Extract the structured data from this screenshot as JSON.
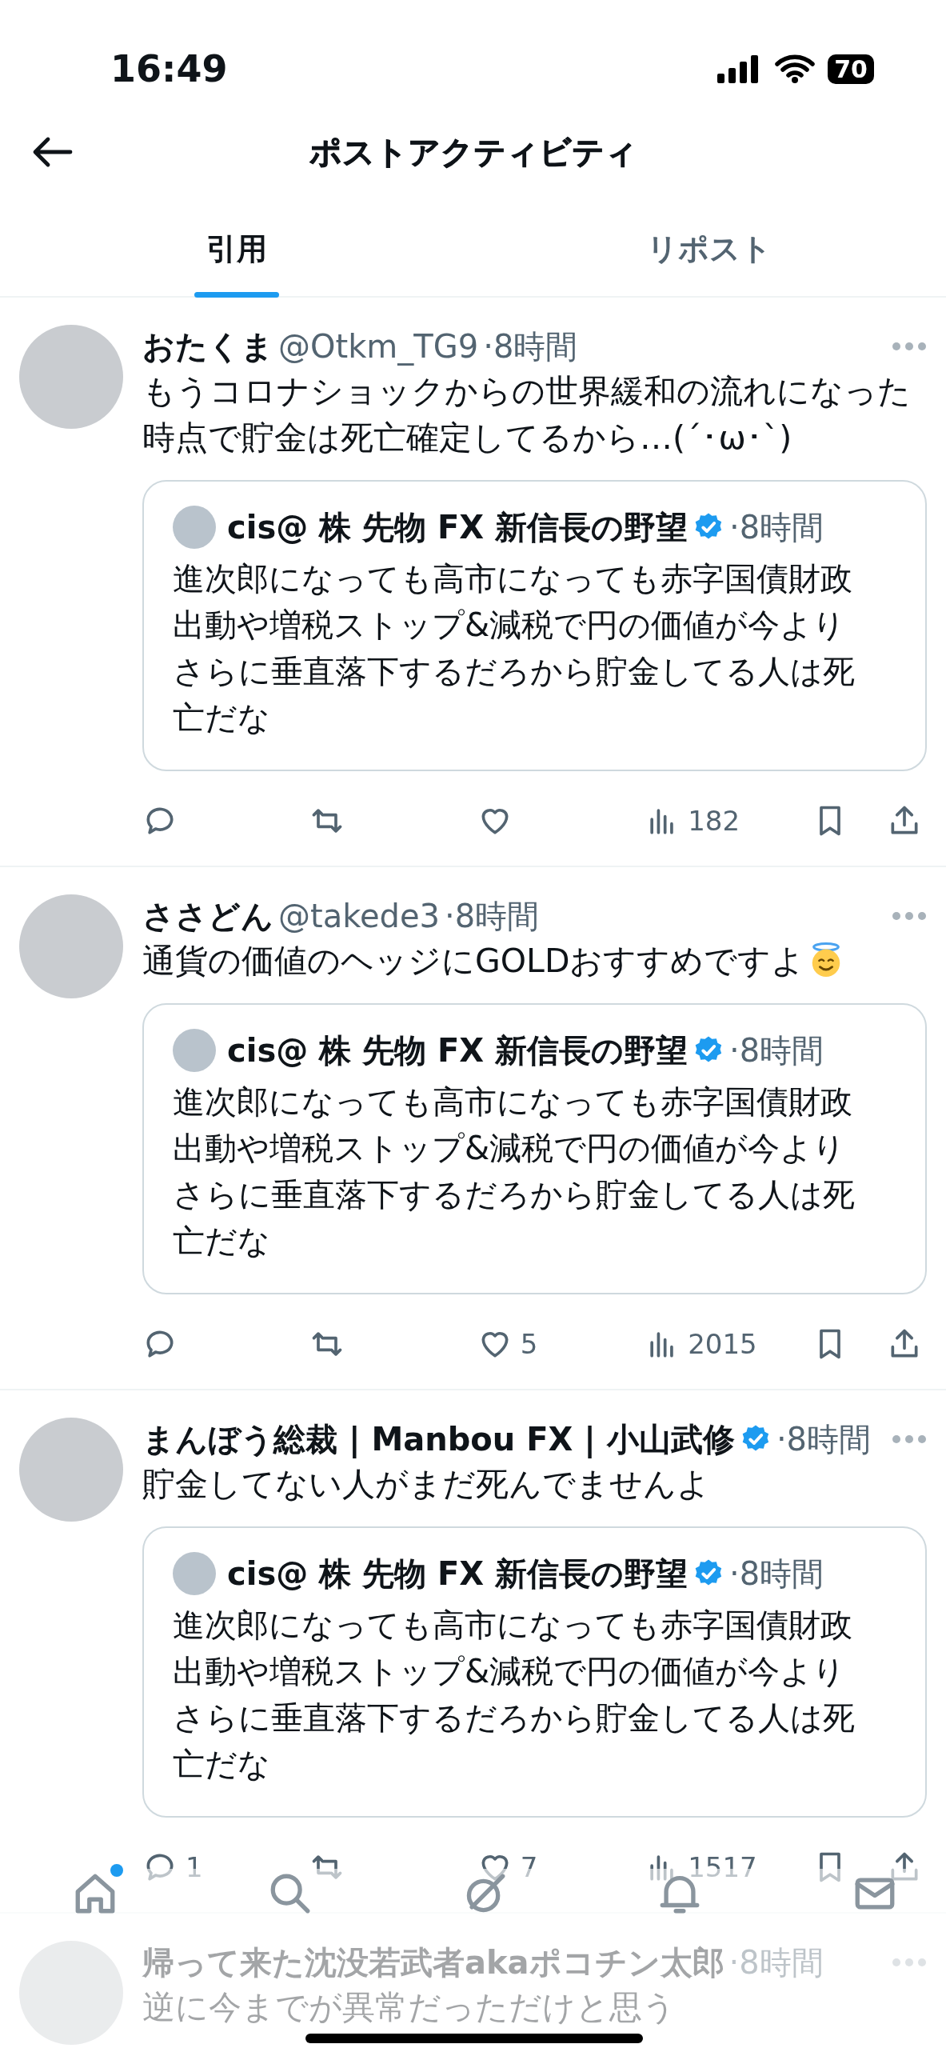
{
  "status_bar": {
    "time": "16:49",
    "battery": "70"
  },
  "header": {
    "title": "ポストアクティビティ"
  },
  "tabs": [
    {
      "label": "引用",
      "selected": true
    },
    {
      "label": "リポスト",
      "selected": false
    }
  ],
  "posts": [
    {
      "name": "おたくま",
      "handle": "@Otkm_TG9",
      "time": "·8時間",
      "text": "もうコロナショックからの世界緩和の流れになった時点で貯金は死亡確定してるから…(´･ω･`)",
      "quote": {
        "name": "cis@ 株 先物 FX 新信長の野望",
        "verified": true,
        "time": "·8時間",
        "text": "進次郎になっても高市になっても赤字国債財政出動や増税ストップ&減税で円の価値が今よりさらに垂直落下するだろから貯金してる人は死亡だな"
      },
      "actions": [
        {
          "kind": "reply"
        },
        {
          "kind": "repost"
        },
        {
          "kind": "like"
        },
        {
          "kind": "views",
          "count": "182"
        },
        {
          "kind": "bookmark"
        },
        {
          "kind": "share"
        }
      ]
    },
    {
      "name": "ささどん",
      "handle": "@takede3",
      "time": "·8時間",
      "text": "通貨の価値のヘッジにGOLDおすすめですよ",
      "emoji": true,
      "quote": {
        "name": "cis@ 株 先物 FX 新信長の野望",
        "verified": true,
        "time": "·8時間",
        "text": "進次郎になっても高市になっても赤字国債財政出動や増税ストップ&減税で円の価値が今よりさらに垂直落下するだろから貯金してる人は死亡だな"
      },
      "actions": [
        {
          "kind": "reply"
        },
        {
          "kind": "repost"
        },
        {
          "kind": "like",
          "count": "5"
        },
        {
          "kind": "views",
          "count": "2015"
        },
        {
          "kind": "bookmark"
        },
        {
          "kind": "share"
        }
      ]
    },
    {
      "name": "まんぼう総裁 | Manbou FX | 小山武修",
      "verified": true,
      "time": "·8時間",
      "text": "貯金してない人がまだ死んでませんよ",
      "quote": {
        "name": "cis@ 株 先物 FX 新信長の野望",
        "verified": true,
        "time": "·8時間",
        "text": "進次郎になっても高市になっても赤字国債財政出動や増税ストップ&減税で円の価値が今よりさらに垂直落下するだろから貯金してる人は死亡だな"
      },
      "actions": [
        {
          "kind": "reply",
          "count": "1"
        },
        {
          "kind": "repost"
        },
        {
          "kind": "like",
          "count": "7"
        },
        {
          "kind": "views",
          "count": "1517"
        },
        {
          "kind": "bookmark"
        },
        {
          "kind": "share"
        }
      ]
    },
    {
      "name": "帰って来た沈没若武者akaポコチン太郎",
      "time": "·8時間",
      "text": "逆に今までが異常だっただけと思う"
    }
  ],
  "bottom_nav": [
    {
      "kind": "home",
      "badge": true
    },
    {
      "kind": "search"
    },
    {
      "kind": "explore"
    },
    {
      "kind": "notifications"
    },
    {
      "kind": "messages"
    }
  ]
}
